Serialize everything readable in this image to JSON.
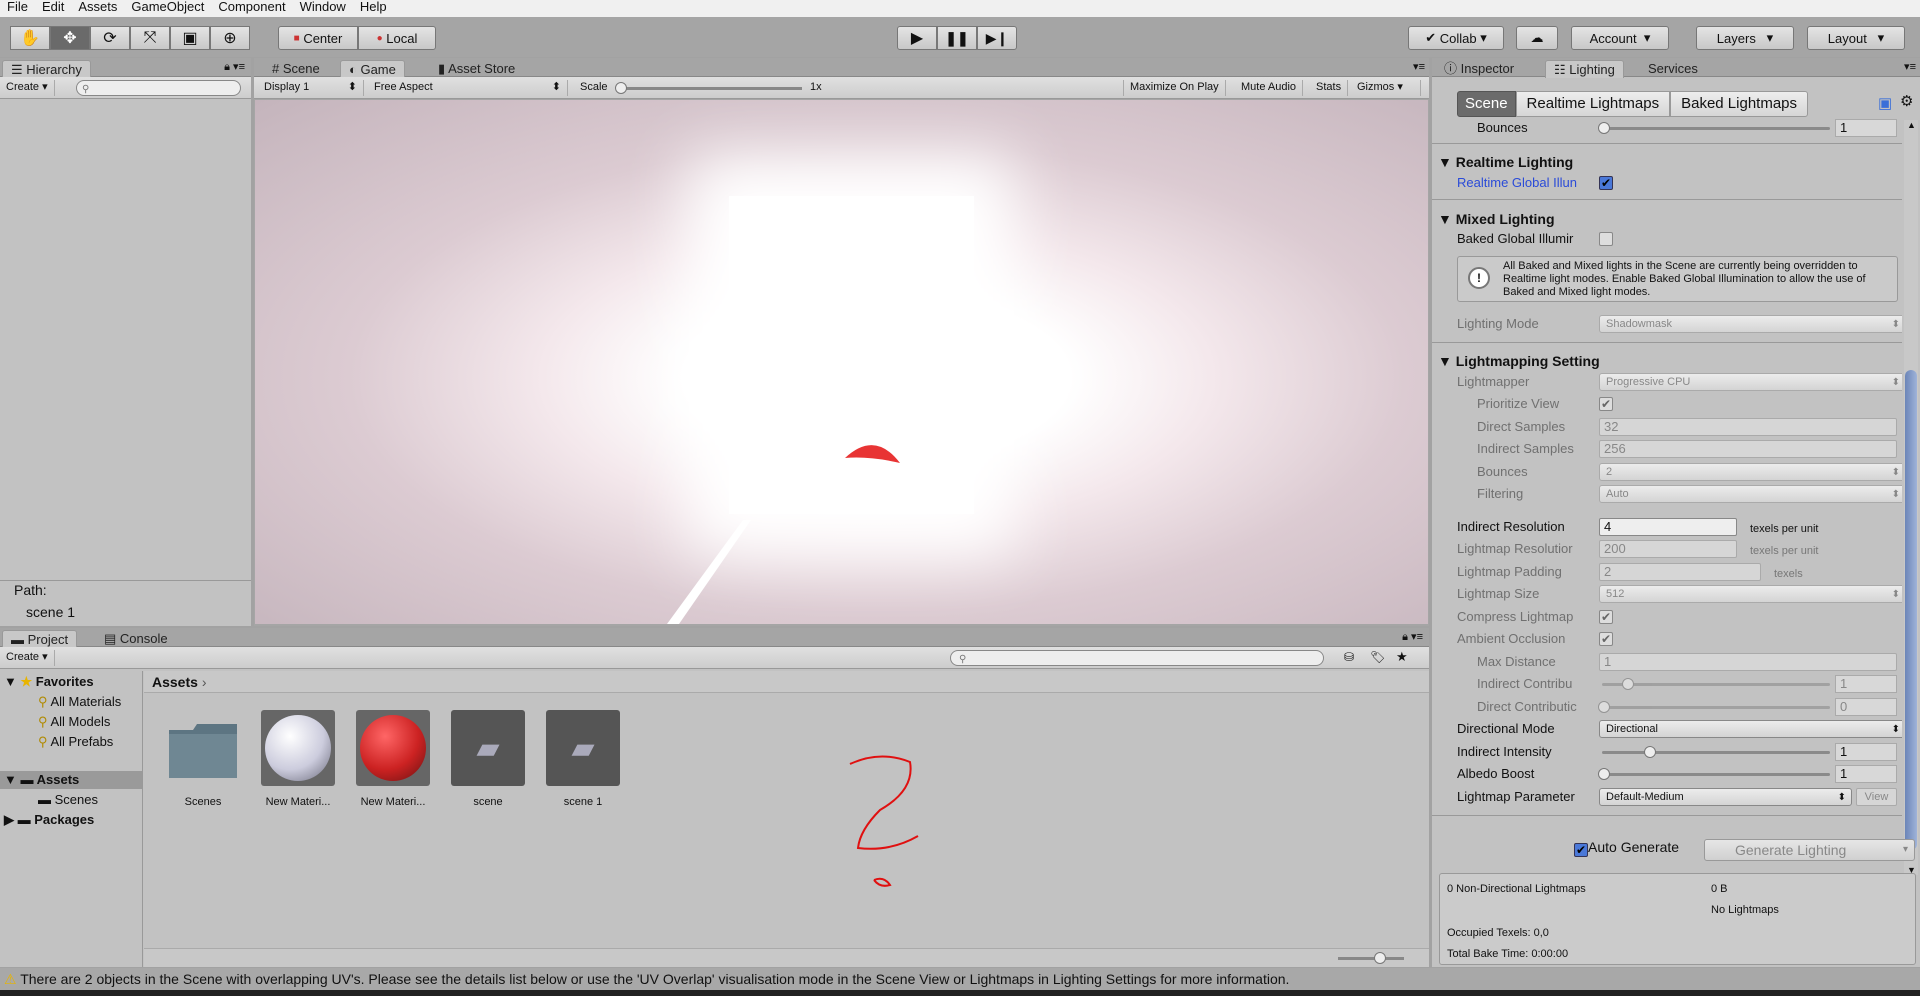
{
  "menu": [
    "File",
    "Edit",
    "Assets",
    "GameObject",
    "Component",
    "Window",
    "Help"
  ],
  "toolbar": {
    "tools": [
      "hand-tool",
      "move-tool",
      "rotate-tool",
      "scale-tool",
      "rect-tool",
      "transform-tool"
    ],
    "pivot": "Center",
    "space": "Local",
    "collab": "Collab",
    "account": "Account",
    "layers": "Layers",
    "layout": "Layout"
  },
  "hierarchy": {
    "tab": "Hierarchy",
    "create": "Create",
    "path_label": "Path:",
    "path_value": "scene 1"
  },
  "game": {
    "tabs": [
      "Scene",
      "Game",
      "Asset Store"
    ],
    "display": "Display 1",
    "aspect": "Free Aspect",
    "scale_label": "Scale",
    "scale_value": "1x",
    "maximize": "Maximize On Play",
    "mute": "Mute Audio",
    "stats": "Stats",
    "gizmos": "Gizmos"
  },
  "project": {
    "tabs": [
      "Project",
      "Console"
    ],
    "create": "Create",
    "favorites": "Favorites",
    "fav_items": [
      "All Materials",
      "All Models",
      "All Prefabs"
    ],
    "assets": "Assets",
    "scenes": "Scenes",
    "packages": "Packages",
    "breadcrumb": "Assets",
    "items": [
      "Scenes",
      "New Materi...",
      "New Materi...",
      "scene",
      "scene 1"
    ]
  },
  "right": {
    "tabs": [
      "Inspector",
      "Lighting",
      "Services"
    ],
    "subtabs": [
      "Scene",
      "Realtime Lightmaps",
      "Baked Lightmaps"
    ],
    "bounces_top": {
      "label": "Bounces",
      "value": "1"
    },
    "realtime_header": "Realtime Lighting",
    "realtime_gi": "Realtime Global Illun",
    "mixed_header": "Mixed Lighting",
    "baked_gi": "Baked Global Illumir",
    "help": "All Baked and Mixed lights in the Scene are currently being overridden to Realtime light modes. Enable Baked Global Illumination to allow the use of Baked and Mixed light modes.",
    "lighting_mode": {
      "label": "Lighting Mode",
      "value": "Shadowmask"
    },
    "lm_header": "Lightmapping Setting",
    "lightmapper": {
      "label": "Lightmapper",
      "value": "Progressive CPU"
    },
    "prioritize": "Prioritize View",
    "direct_samples": {
      "label": "Direct Samples",
      "value": "32"
    },
    "indirect_samples": {
      "label": "Indirect Samples",
      "value": "256"
    },
    "bounces": {
      "label": "Bounces",
      "value": "2"
    },
    "filtering": {
      "label": "Filtering",
      "value": "Auto"
    },
    "indirect_res": {
      "label": "Indirect Resolution",
      "value": "4",
      "unit": "texels per unit"
    },
    "lightmap_res": {
      "label": "Lightmap Resolutior",
      "value": "200",
      "unit": "texels per unit"
    },
    "padding": {
      "label": "Lightmap Padding",
      "value": "2",
      "unit": "texels"
    },
    "size": {
      "label": "Lightmap Size",
      "value": "512"
    },
    "compress": "Compress Lightmap",
    "ao": "Ambient Occlusion",
    "max_distance": {
      "label": "Max Distance",
      "value": "1"
    },
    "indirect_contrib": {
      "label": "Indirect Contribu",
      "value": "1"
    },
    "direct_contrib": {
      "label": "Direct Contributic",
      "value": "0"
    },
    "directional_mode": {
      "label": "Directional Mode",
      "value": "Directional"
    },
    "indirect_intensity": {
      "label": "Indirect Intensity",
      "value": "1"
    },
    "albedo": {
      "label": "Albedo Boost",
      "value": "1"
    },
    "lm_params": {
      "label": "Lightmap Parameter",
      "value": "Default-Medium",
      "view": "View"
    },
    "auto_generate": "Auto Generate",
    "generate": "Generate Lighting",
    "stats": {
      "nondir": "0 Non-Directional Lightmaps",
      "size": "0 B",
      "none": "No Lightmaps",
      "occupied": "Occupied Texels: 0,0",
      "bake_time": "Total Bake Time: 0:00:00"
    }
  },
  "status": "There are 2 objects in the Scene with overlapping UV's. Please see the details list below or use the 'UV Overlap' visualisation mode in the Scene View or Lightmaps in Lighting Settings for more information.",
  "colors": {
    "accent": "#3a6fd8",
    "warning": "#e8b400",
    "red_material": "#d42a2a"
  }
}
